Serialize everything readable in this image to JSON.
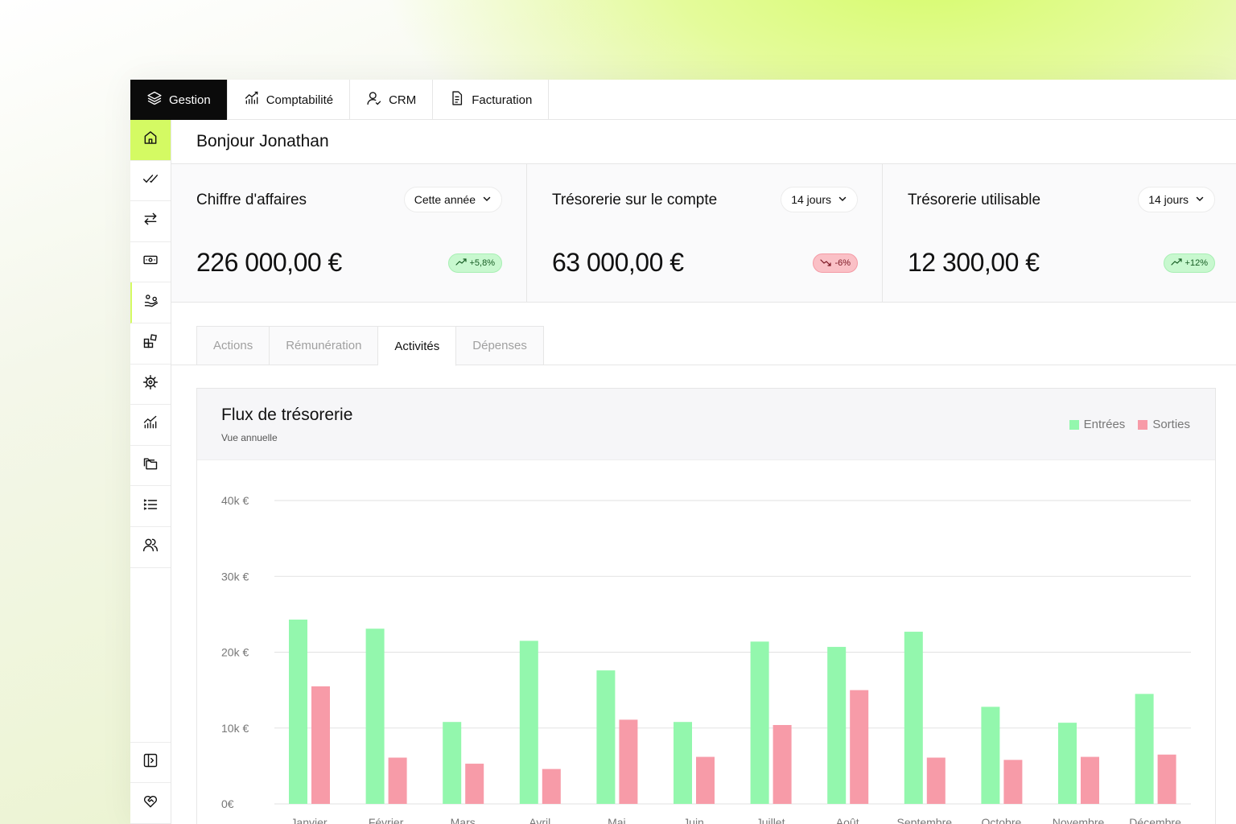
{
  "topnav": {
    "tabs": [
      {
        "label": "Gestion",
        "icon": "layers-icon"
      },
      {
        "label": "Comptabilité",
        "icon": "chart-growth-icon"
      },
      {
        "label": "CRM",
        "icon": "user-icon"
      },
      {
        "label": "Facturation",
        "icon": "document-icon"
      }
    ]
  },
  "sidebar": {
    "items": [
      "home-icon",
      "double-check-icon",
      "transfer-icon",
      "cash-icon",
      "hand-money-icon",
      "widgets-icon",
      "helm-icon",
      "chart-growth-icon",
      "folders-icon",
      "list-icon",
      "users-icon"
    ],
    "bottom": [
      "sidebar-toggle-icon",
      "heart-handshake-icon"
    ]
  },
  "greeting": "Bonjour Jonathan",
  "kpis": [
    {
      "title": "Chiffre d'affaires",
      "period": "Cette année",
      "value": "226 000,00 €",
      "trend": "+5,8%",
      "direction": "up"
    },
    {
      "title": "Trésorerie sur le compte",
      "period": "14 jours",
      "value": "63 000,00 €",
      "trend": "-6%",
      "direction": "down"
    },
    {
      "title": "Trésorerie utilisable",
      "period": "14 jours",
      "value": "12 300,00 €",
      "trend": "+12%",
      "direction": "up"
    }
  ],
  "subtabs": [
    {
      "label": "Actions",
      "active": false
    },
    {
      "label": "Rémunération",
      "active": false
    },
    {
      "label": "Activités",
      "active": true
    },
    {
      "label": "Dépenses",
      "active": false
    }
  ],
  "card": {
    "title": "Flux de trésorerie",
    "subtitle": "Vue annuelle"
  },
  "colors": {
    "accent": "#d4fa63",
    "entrees": "#93f7ad",
    "sorties": "#f79ba8"
  },
  "chart_data": {
    "type": "bar",
    "categories": [
      "Janvier",
      "Février",
      "Mars",
      "Avril",
      "Mai",
      "Juin",
      "Juillet",
      "Août",
      "Septembre",
      "Octobre",
      "Novembre",
      "Décembre"
    ],
    "series": [
      {
        "name": "Entrées",
        "values": [
          24300,
          23100,
          10800,
          21500,
          17600,
          10800,
          21400,
          20700,
          22700,
          12800,
          10700,
          14500
        ]
      },
      {
        "name": "Sorties",
        "values": [
          15500,
          6100,
          5300,
          4600,
          11100,
          6200,
          10400,
          15000,
          6100,
          5800,
          6200,
          6500
        ]
      }
    ],
    "ylim": [
      0,
      40000
    ],
    "yticks": [
      {
        "value": 40000,
        "label": "40k €"
      },
      {
        "value": 30000,
        "label": "30k €"
      },
      {
        "value": 20000,
        "label": "20k €"
      },
      {
        "value": 10000,
        "label": "10k €"
      },
      {
        "value": 0,
        "label": "0€"
      }
    ],
    "grid": true,
    "legend": "top-right"
  }
}
